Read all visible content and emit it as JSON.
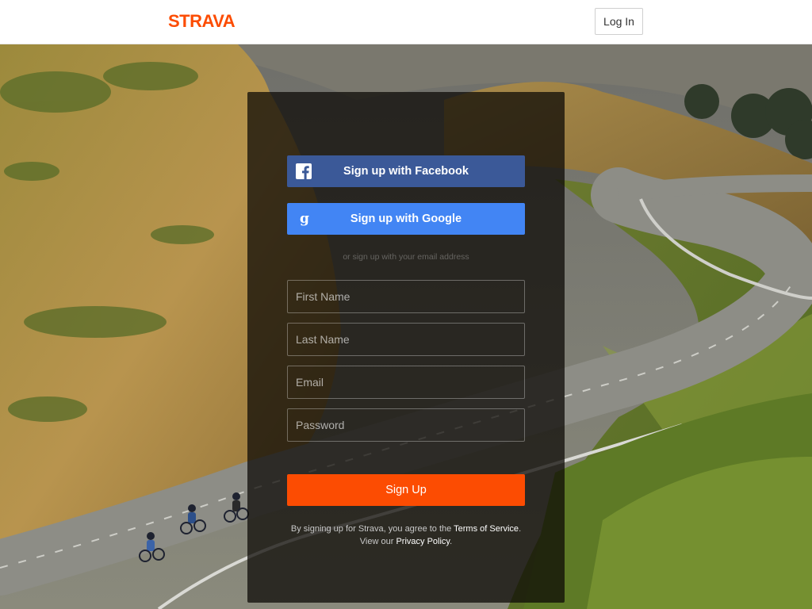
{
  "header": {
    "brand": "STRAVA",
    "login_label": "Log In"
  },
  "signup": {
    "facebook_label": "Sign up with Facebook",
    "google_label": "Sign up with Google",
    "divider": "or sign up with your email address",
    "first_name_placeholder": "First Name",
    "last_name_placeholder": "Last Name",
    "email_placeholder": "Email",
    "password_placeholder": "Password",
    "submit_label": "Sign Up",
    "legal_prefix": "By signing up for Strava, you agree to the",
    "terms_label": "Terms of Service",
    "legal_mid": "View our",
    "privacy_label": "Privacy Policy"
  },
  "icons": {
    "facebook": "facebook-icon",
    "google": "google-icon"
  },
  "colors": {
    "brand": "#fc4c02",
    "facebook": "#3b5998",
    "google": "#4285f4"
  }
}
